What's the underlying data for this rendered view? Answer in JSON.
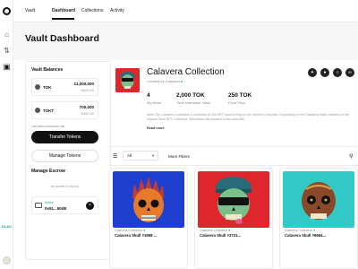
{
  "nav": {
    "tabs": [
      {
        "label": "Vault"
      },
      {
        "label": "Dashboard"
      },
      {
        "label": "Collections"
      },
      {
        "label": "Activity"
      }
    ]
  },
  "rail": {
    "badge": "DLAC"
  },
  "page": {
    "title": "Vault Dashboard"
  },
  "left_panel": {
    "balances_title": "Vault Balances",
    "balances": [
      {
        "token": "TOK",
        "amount": "21,000,000",
        "usd": "$600.00"
      },
      {
        "token": "TOKT",
        "amount": "700,000",
        "usd": "$450.00"
      }
    ],
    "note": "Last token conversion rate",
    "transfer_label": "Transfer Tokens",
    "manage_label": "Manage Tokens",
    "escrow_title": "Manage Escrow",
    "escrow_empty": "No assets in escrow",
    "escrow_item": {
      "status": "Active",
      "id": "0x91...50dE"
    }
  },
  "collection": {
    "title": "Calavera Collection",
    "created_by": "Created by Calavera",
    "stats": [
      {
        "value": "4",
        "label": "My Items"
      },
      {
        "value": "2,000 TOK",
        "label": "Total Estimated Value"
      },
      {
        "value": "250 TOK",
        "label": "Floor Price"
      }
    ],
    "description": "Meet The Calavera Collection! A collection of 10k NFT Skulls living on the Internet Computer. Expanding on the Calavera Sides featured in the original Tarot NFT Collection, @toniobar has created a new spin with",
    "read_more": "Read more",
    "socials": [
      "twitter-icon",
      "discord-icon",
      "globe-icon",
      "link-icon"
    ]
  },
  "filters": {
    "select_value": "All",
    "more_filters": "More Filters"
  },
  "nfts": [
    {
      "collection": "Calavera Collection",
      "name": "Calavera Skull #1998 ..."
    },
    {
      "collection": "Calavera Collection",
      "name": "Calavera Skull #3721..."
    },
    {
      "collection": "Calavera Collection",
      "name": "Calavera Skull #6664..."
    }
  ],
  "colors": {
    "accent": "#111111",
    "verified": "#19b36b",
    "nft_bg_1": "#1f3fcf",
    "nft_bg_2": "#e0262d",
    "nft_bg_3": "#33c9c7"
  }
}
